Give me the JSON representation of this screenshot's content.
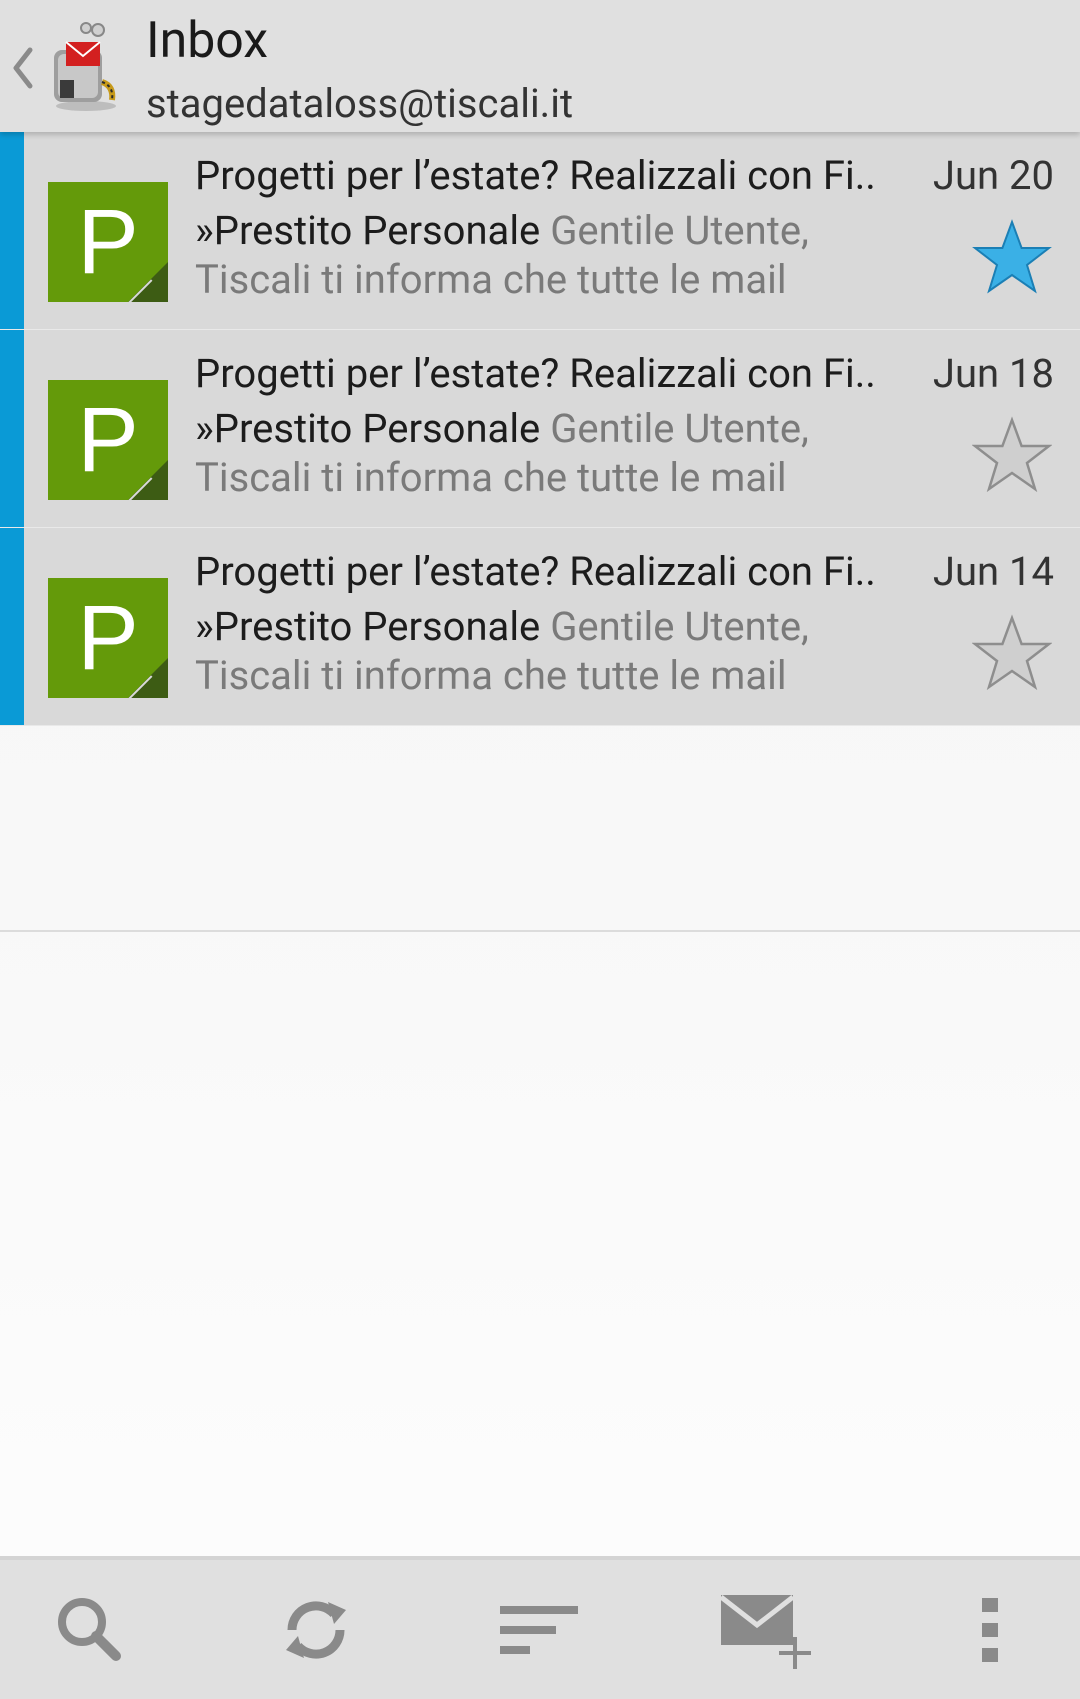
{
  "header": {
    "title": "Inbox",
    "account": "stagedataloss@tiscali.it"
  },
  "colors": {
    "unread_accent": "#0a9ad6",
    "avatar_green": "#649a0a",
    "star_active": "#3ab0e6",
    "star_inactive": "#a8a8a8"
  },
  "messages": [
    {
      "avatar_letter": "P",
      "subject": "Progetti per l’estate? Realizzali con Fi..",
      "date": "Jun 20",
      "sender": "»Prestito Personale",
      "preview": "Gentile Utente, Tiscali ti informa che tutte le mail",
      "starred": true
    },
    {
      "avatar_letter": "P",
      "subject": "Progetti per l’estate? Realizzali con Fi..",
      "date": "Jun 18",
      "sender": "»Prestito Personale",
      "preview": "Gentile Utente, Tiscali ti informa che tutte le mail",
      "starred": false
    },
    {
      "avatar_letter": "P",
      "subject": "Progetti per l’estate? Realizzali con Fi..",
      "date": "Jun 14",
      "sender": "»Prestito Personale",
      "preview": "Gentile Utente, Tiscali ti informa che tutte le mail",
      "starred": false
    }
  ],
  "toolbar": {
    "icons": [
      "search-icon",
      "refresh-icon",
      "sort-icon",
      "compose-icon",
      "overflow-menu-icon"
    ]
  }
}
